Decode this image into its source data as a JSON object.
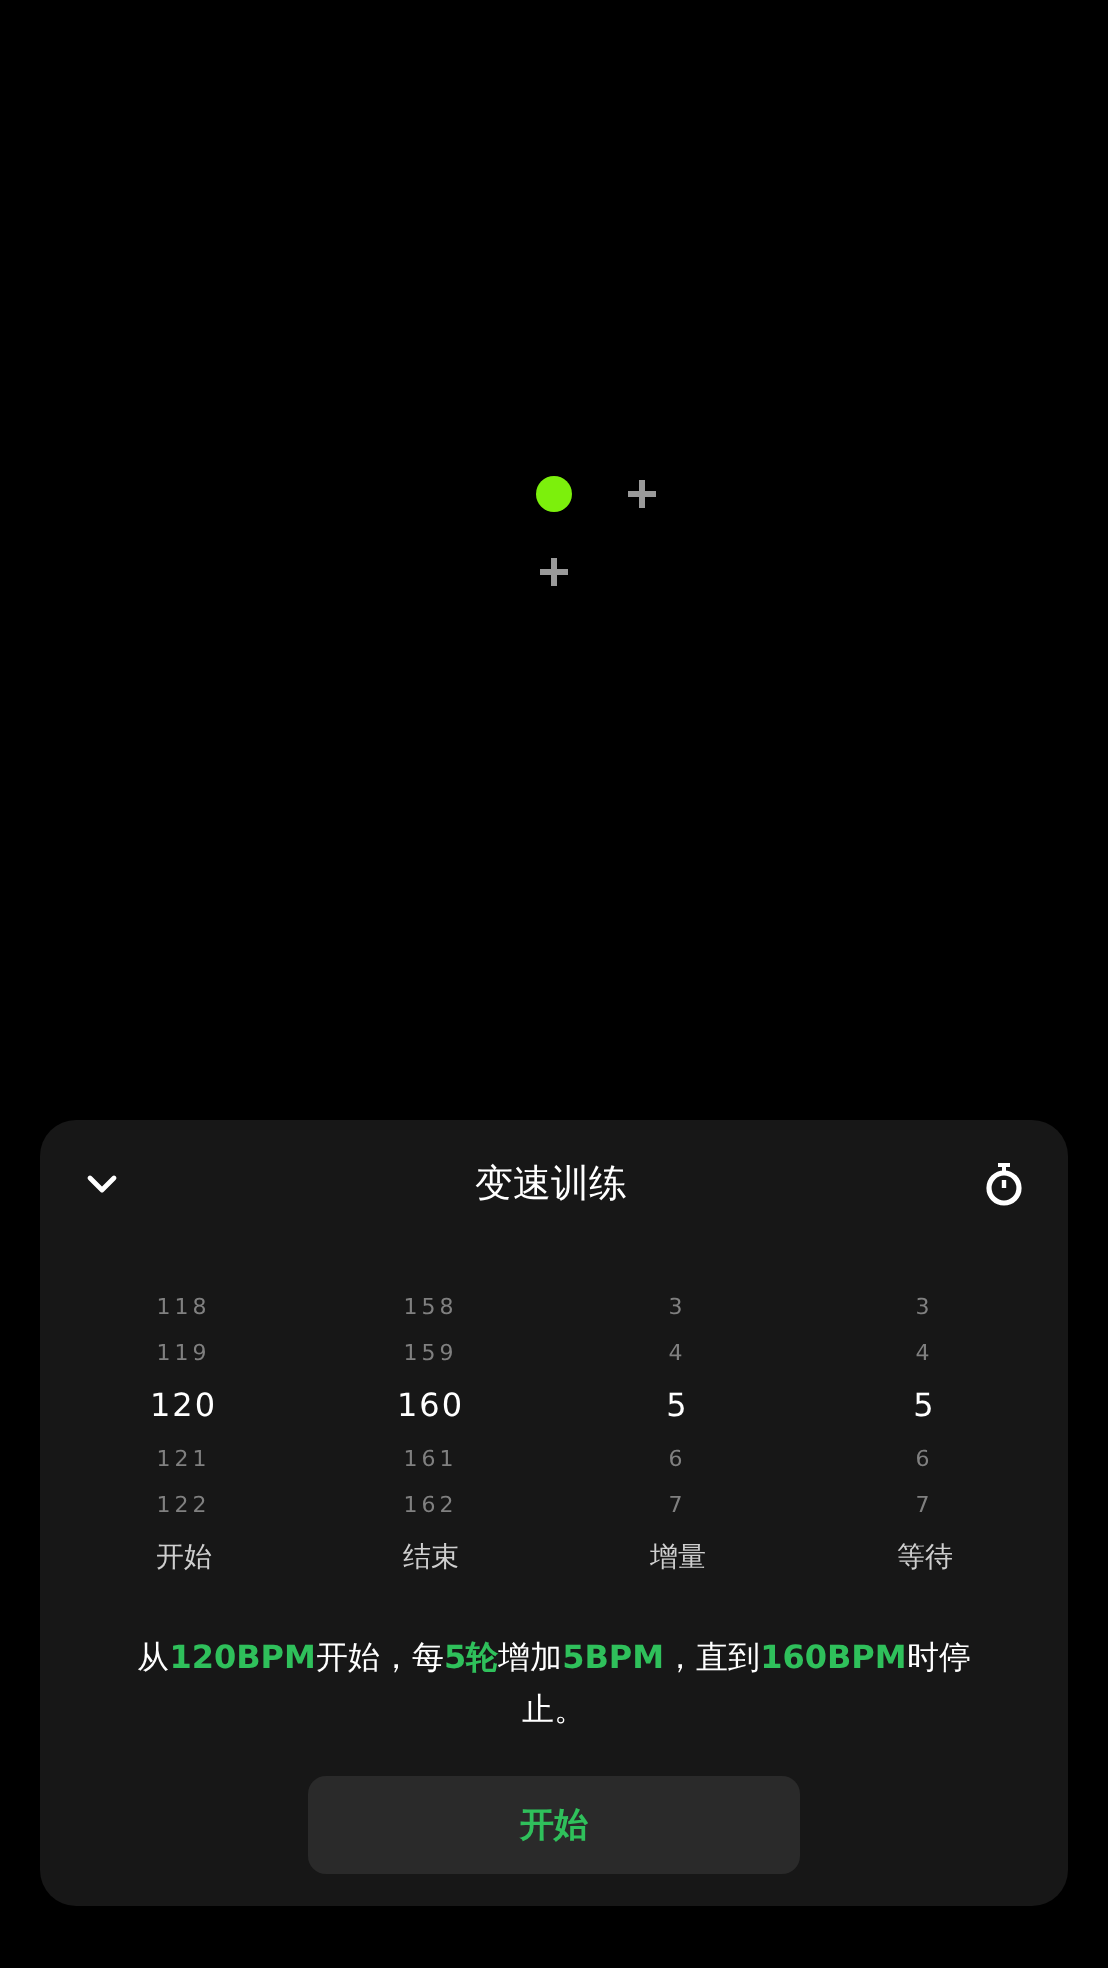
{
  "beats": [
    {
      "kind": "dot",
      "color": "#7cf00c"
    },
    {
      "kind": "add"
    },
    {
      "kind": "add"
    }
  ],
  "sheet": {
    "title": "变速训练",
    "pickers": [
      {
        "label": "开始",
        "items": [
          {
            "value": "118",
            "selected": false
          },
          {
            "value": "119",
            "selected": false
          },
          {
            "value": "120",
            "selected": true
          },
          {
            "value": "121",
            "selected": false
          },
          {
            "value": "122",
            "selected": false
          }
        ]
      },
      {
        "label": "结束",
        "items": [
          {
            "value": "158",
            "selected": false
          },
          {
            "value": "159",
            "selected": false
          },
          {
            "value": "160",
            "selected": true
          },
          {
            "value": "161",
            "selected": false
          },
          {
            "value": "162",
            "selected": false
          }
        ]
      },
      {
        "label": "增量",
        "items": [
          {
            "value": "3",
            "selected": false
          },
          {
            "value": "4",
            "selected": false
          },
          {
            "value": "5",
            "selected": true
          },
          {
            "value": "6",
            "selected": false
          },
          {
            "value": "7",
            "selected": false
          }
        ]
      },
      {
        "label": "等待",
        "items": [
          {
            "value": "3",
            "selected": false
          },
          {
            "value": "4",
            "selected": false
          },
          {
            "value": "5",
            "selected": true
          },
          {
            "value": "6",
            "selected": false
          },
          {
            "value": "7",
            "selected": false
          }
        ]
      }
    ],
    "summary": [
      {
        "text": "从",
        "highlight": false
      },
      {
        "text": "120BPM",
        "highlight": true
      },
      {
        "text": "开始，每",
        "highlight": false
      },
      {
        "text": "5轮",
        "highlight": true
      },
      {
        "text": "增加",
        "highlight": false
      },
      {
        "text": "5BPM",
        "highlight": true
      },
      {
        "text": "，直到",
        "highlight": false
      },
      {
        "text": "160BPM",
        "highlight": true
      },
      {
        "text": "时停止。",
        "highlight": false
      }
    ],
    "start_button": "开始"
  }
}
